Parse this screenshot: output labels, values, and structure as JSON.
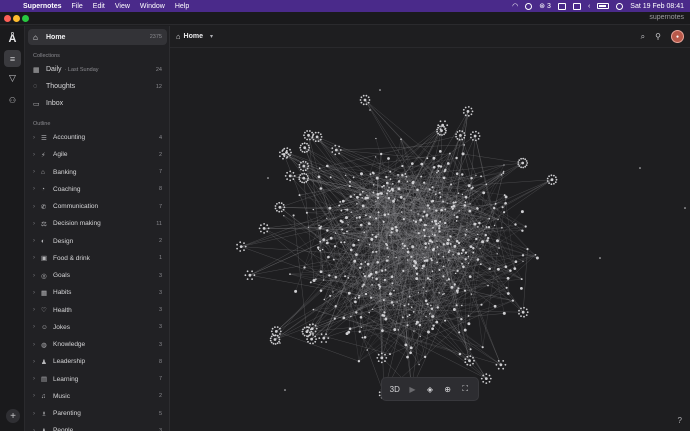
{
  "menubar": {
    "app_name": "Supernotes",
    "menus": [
      "File",
      "Edit",
      "View",
      "Window",
      "Help"
    ],
    "notification_count": "3",
    "clock": "Sat 19 Feb  08:41"
  },
  "window": {
    "brand": "supernotes"
  },
  "sidebar": {
    "home": {
      "label": "Home",
      "count": "2375"
    },
    "collections_label": "Collections",
    "collections": [
      {
        "icon": "calendar-icon",
        "glyph": "▦",
        "label": "Daily",
        "sub": "· Last Sunday",
        "count": "24"
      },
      {
        "icon": "speech-bubble-icon",
        "glyph": "◌",
        "label": "Thoughts",
        "sub": "",
        "count": "12"
      },
      {
        "icon": "inbox-icon",
        "glyph": "▭",
        "label": "Inbox",
        "sub": "",
        "count": ""
      }
    ],
    "outline_label": "Outline",
    "outline": [
      {
        "icon": "ledger-icon",
        "glyph": "☰",
        "label": "Accounting",
        "count": "4"
      },
      {
        "icon": "running-icon",
        "glyph": "⚡",
        "label": "Agile",
        "count": "2"
      },
      {
        "icon": "bank-icon",
        "glyph": "⌂",
        "label": "Banking",
        "count": "7"
      },
      {
        "icon": "whistle-icon",
        "glyph": "◔",
        "label": "Coaching",
        "count": "8"
      },
      {
        "icon": "phone-icon",
        "glyph": "✆",
        "label": "Communication",
        "count": "7"
      },
      {
        "icon": "balance-icon",
        "glyph": "⚖",
        "label": "Decision making",
        "count": "11"
      },
      {
        "icon": "palette-icon",
        "glyph": "◐",
        "label": "Design",
        "count": "2"
      },
      {
        "icon": "food-icon",
        "glyph": "▣",
        "label": "Food & drink",
        "count": "1"
      },
      {
        "icon": "target-icon",
        "glyph": "◎",
        "label": "Goals",
        "count": "3"
      },
      {
        "icon": "calendar-icon",
        "glyph": "▦",
        "label": "Habits",
        "count": "3"
      },
      {
        "icon": "heart-icon",
        "glyph": "♡",
        "label": "Health",
        "count": "3"
      },
      {
        "icon": "smile-icon",
        "glyph": "☺",
        "label": "Jokes",
        "count": "3"
      },
      {
        "icon": "bulb-icon",
        "glyph": "◍",
        "label": "Knowledge",
        "count": "3"
      },
      {
        "icon": "people-icon",
        "glyph": "♟",
        "label": "Leadership",
        "count": "8"
      },
      {
        "icon": "book-icon",
        "glyph": "▤",
        "label": "Learning",
        "count": "7"
      },
      {
        "icon": "music-icon",
        "glyph": "♫",
        "label": "Music",
        "count": "2"
      },
      {
        "icon": "child-icon",
        "glyph": "♗",
        "label": "Parenting",
        "count": "5"
      },
      {
        "icon": "people-icon",
        "glyph": "♟",
        "label": "People",
        "count": "3"
      }
    ]
  },
  "main": {
    "breadcrumb": "Home",
    "graph_controls": [
      "3D",
      "▶",
      "◈",
      "⊕",
      "⛶"
    ],
    "help": "?"
  },
  "colors": {
    "menubar": "#4a2a8a",
    "background": "#1e1e20",
    "sidebar": "#212124",
    "graph_node": "#cfcfd2"
  }
}
